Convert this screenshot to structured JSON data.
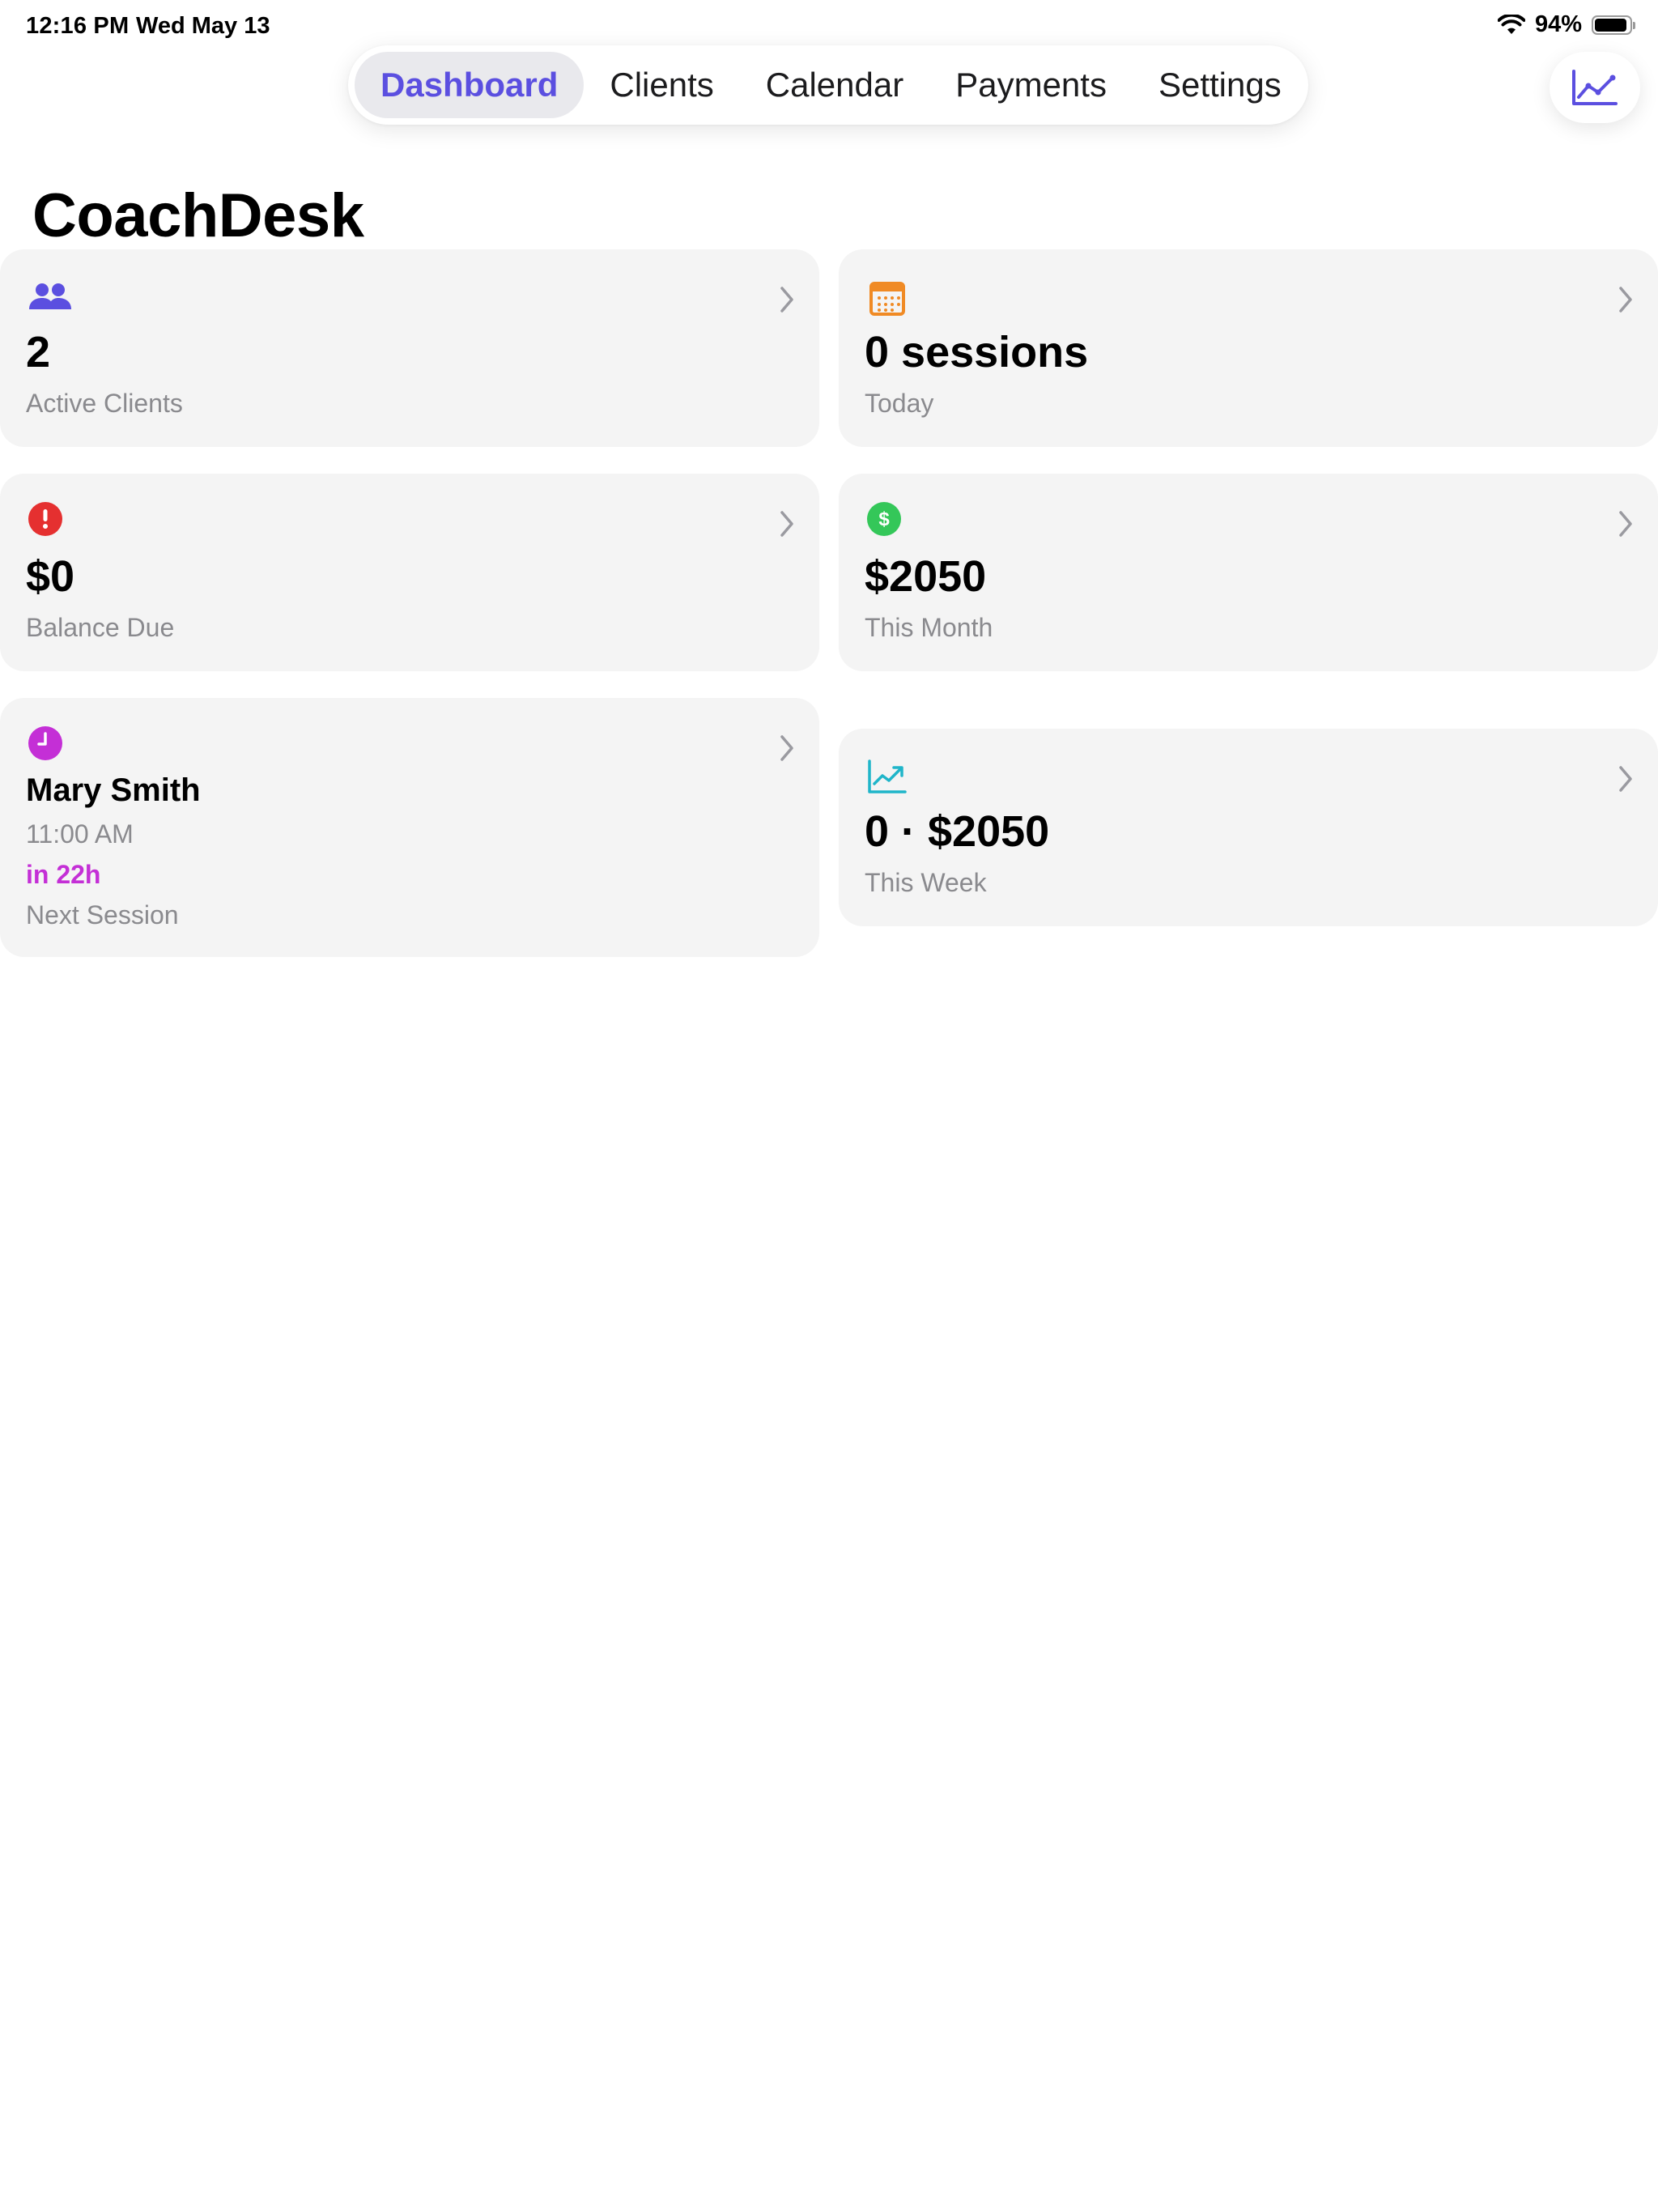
{
  "status_bar": {
    "time": "12:16 PM",
    "date": "Wed May 13",
    "battery_percent": "94%",
    "battery_level": 0.94,
    "wifi_icon": "wifi-icon",
    "battery_icon": "battery-icon"
  },
  "nav": {
    "tabs": [
      {
        "label": "Dashboard",
        "active": true
      },
      {
        "label": "Clients",
        "active": false
      },
      {
        "label": "Calendar",
        "active": false
      },
      {
        "label": "Payments",
        "active": false
      },
      {
        "label": "Settings",
        "active": false
      }
    ],
    "right_button_icon": "chart-line-uptrend-icon"
  },
  "page": {
    "title": "CoachDesk"
  },
  "cards": {
    "active_clients": {
      "value": "2",
      "label": "Active Clients",
      "icon": "people-icon",
      "color": "#5b4fe0"
    },
    "sessions_today": {
      "value": "0 sessions",
      "label": "Today",
      "icon": "calendar-icon",
      "color": "#f08a24"
    },
    "balance_due": {
      "value": "$0",
      "label": "Balance Due",
      "icon": "exclamation-circle-icon",
      "color": "#e53030"
    },
    "this_month": {
      "value": "$2050",
      "label": "This Month",
      "icon": "dollar-circle-icon",
      "color": "#34c759"
    },
    "next_session": {
      "name": "Mary Smith",
      "time": "11:00 AM",
      "countdown": "in 22h",
      "label": "Next Session",
      "icon": "clock-icon",
      "color": "#c42fd6"
    },
    "this_week": {
      "value": "0 · $2050",
      "label": "This Week",
      "icon": "chart-uptrend-icon",
      "color": "#1fb5c9"
    }
  },
  "colors": {
    "accent": "#5b4fe0",
    "card_bg": "#f4f4f4",
    "secondary_text": "#8a8a8e"
  }
}
